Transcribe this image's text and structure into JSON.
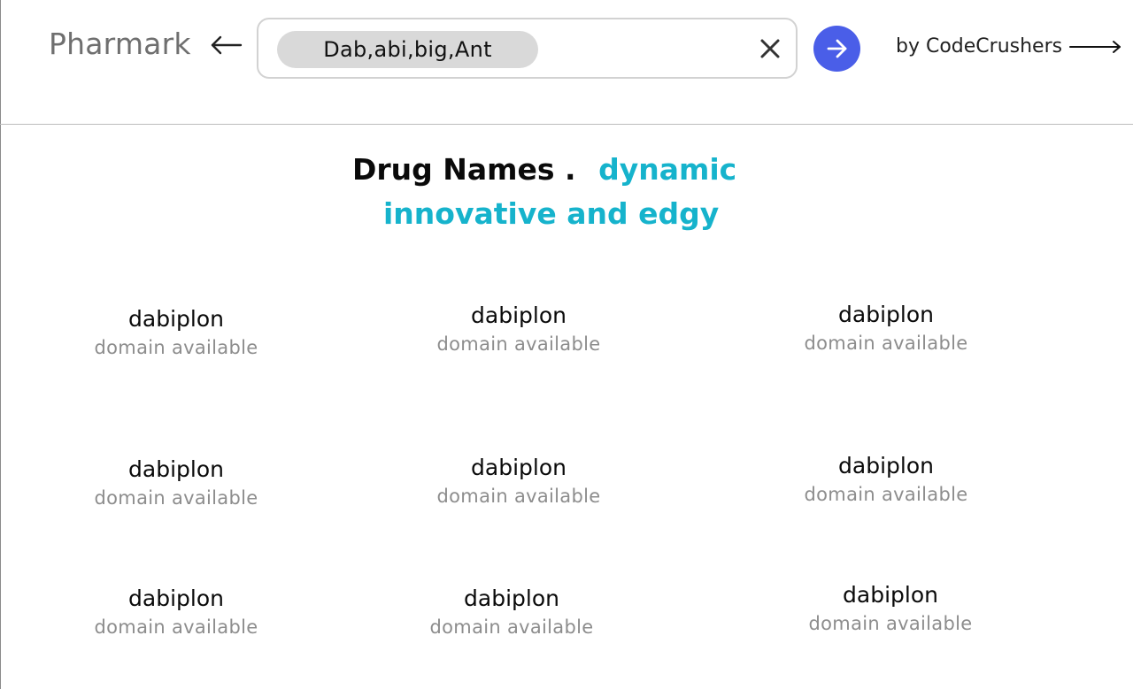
{
  "header": {
    "brand": "Pharmark",
    "search_chip": "Dab,abi,big,Ant",
    "credit": "by CodeCrushers"
  },
  "headline": {
    "title": "Drug Names .",
    "accent_1": "dynamic",
    "accent_2": "innovative and edgy"
  },
  "results": [
    {
      "name": "dabiplon",
      "status": "domain available"
    },
    {
      "name": "dabiplon",
      "status": "domain available"
    },
    {
      "name": "dabiplon",
      "status": "domain available"
    },
    {
      "name": "dabiplon",
      "status": "domain available"
    },
    {
      "name": "dabiplon",
      "status": "domain available"
    },
    {
      "name": "dabiplon",
      "status": "domain available"
    },
    {
      "name": "dabiplon",
      "status": "domain available"
    },
    {
      "name": "dabiplon",
      "status": "domain available"
    },
    {
      "name": "dabiplon",
      "status": "domain available"
    }
  ],
  "colors": {
    "accent": "#16b3cc",
    "go_button": "#4a5ee8",
    "chip_bg": "#d9d9d9",
    "muted_text": "#8d8d8d"
  },
  "icons": {
    "back": "arrow-left-icon",
    "clear": "close-icon",
    "go": "arrow-right-icon",
    "credit": "long-arrow-right-icon"
  }
}
